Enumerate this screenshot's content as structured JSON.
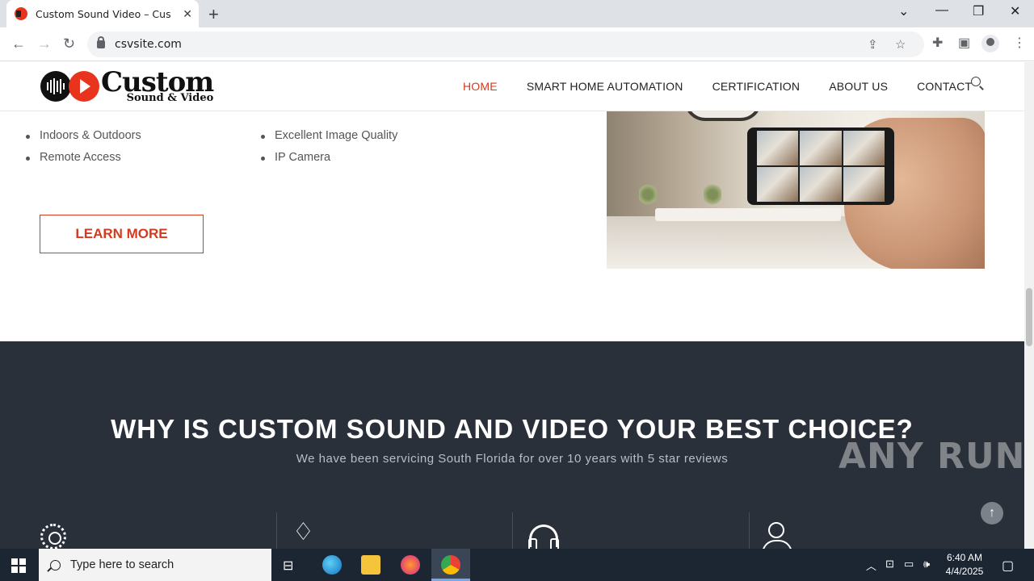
{
  "browser": {
    "tab_title": "Custom Sound Video – Custom",
    "url": "csvsite.com"
  },
  "site": {
    "logo_main": "Custom",
    "logo_sub": "Sound & Video",
    "nav": [
      "HOME",
      "SMART HOME AUTOMATION",
      "CERTIFICATION",
      "ABOUT US",
      "CONTACT"
    ],
    "active_nav": "HOME",
    "accent_color": "#d33a1e"
  },
  "features": {
    "col1": [
      "Indoors & Outdoors",
      "Remote Access"
    ],
    "col2": [
      "Excellent Image Quality",
      "IP Camera"
    ],
    "button": "LEARN MORE"
  },
  "why": {
    "title": "WHY IS CUSTOM SOUND AND VIDEO YOUR BEST CHOICE?",
    "subtitle": "We have been servicing South Florida for over 10 years with 5 star reviews",
    "icons": [
      "gear-icon",
      "diamond-icon",
      "headset-icon",
      "user-check-icon"
    ],
    "background": "#29303a"
  },
  "watermark": "ANY RUN",
  "taskbar": {
    "search_placeholder": "Type here to search",
    "time": "6:40 AM",
    "date": "4/4/2025"
  }
}
